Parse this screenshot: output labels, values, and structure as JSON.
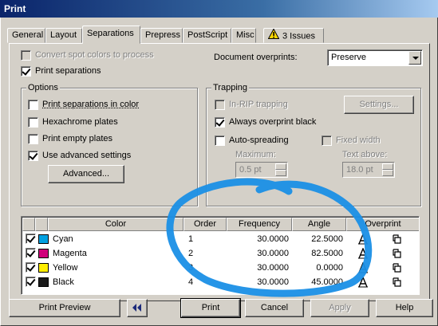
{
  "window": {
    "title": "Print"
  },
  "tabs": [
    {
      "label": "General"
    },
    {
      "label": "Layout"
    },
    {
      "label": "Separations"
    },
    {
      "label": "Prepress"
    },
    {
      "label": "PostScript"
    },
    {
      "label": "Misc"
    },
    {
      "label": "3 Issues"
    }
  ],
  "separations": {
    "convert_spot": {
      "label": "Convert spot colors to process",
      "checked": false,
      "enabled": false
    },
    "print_separations": {
      "label": "Print separations",
      "checked": true
    },
    "document_overprints": {
      "label": "Document overprints:",
      "value": "Preserve"
    },
    "options": {
      "title": "Options",
      "print_in_color": {
        "label": "Print separations in color",
        "checked": false
      },
      "hexachrome": {
        "label": "Hexachrome plates",
        "checked": false
      },
      "print_empty": {
        "label": "Print empty plates",
        "checked": false
      },
      "use_advanced": {
        "label": "Use advanced settings",
        "checked": true
      },
      "advanced_button": "Advanced..."
    },
    "trapping": {
      "title": "Trapping",
      "in_rip": {
        "label": "In-RIP trapping",
        "checked": false,
        "enabled": false
      },
      "settings_button": "Settings...",
      "always_overprint_black": {
        "label": "Always overprint black",
        "checked": true
      },
      "auto_spreading": {
        "label": "Auto-spreading",
        "checked": false
      },
      "fixed_width": {
        "label": "Fixed width",
        "checked": false,
        "enabled": false
      },
      "maximum": {
        "label": "Maximum:",
        "value": "0.5 pt"
      },
      "text_above": {
        "label": "Text above:",
        "value": "18.0 pt"
      }
    },
    "table": {
      "columns": [
        "Color",
        "Order",
        "Frequency",
        "Angle",
        "Overprint"
      ],
      "rows": [
        {
          "checked": true,
          "color": "Cyan",
          "swatch": "#00a0e0",
          "order": "1",
          "frequency": "30.0000",
          "angle": "22.5000"
        },
        {
          "checked": true,
          "color": "Magenta",
          "swatch": "#d0007a",
          "order": "2",
          "frequency": "30.0000",
          "angle": "82.5000"
        },
        {
          "checked": true,
          "color": "Yellow",
          "swatch": "#ffee00",
          "order": "3",
          "frequency": "30.0000",
          "angle": "0.0000"
        },
        {
          "checked": true,
          "color": "Black",
          "swatch": "#1a1a1a",
          "order": "4",
          "frequency": "30.0000",
          "angle": "45.0000"
        }
      ]
    }
  },
  "footer": {
    "print_preview": "Print Preview",
    "print": "Print",
    "cancel": "Cancel",
    "apply": "Apply",
    "help": "Help"
  },
  "colors": {
    "titlebar": "#0a246a",
    "dialog": "#d4d0c8",
    "annotation": "#1a8fe6"
  }
}
